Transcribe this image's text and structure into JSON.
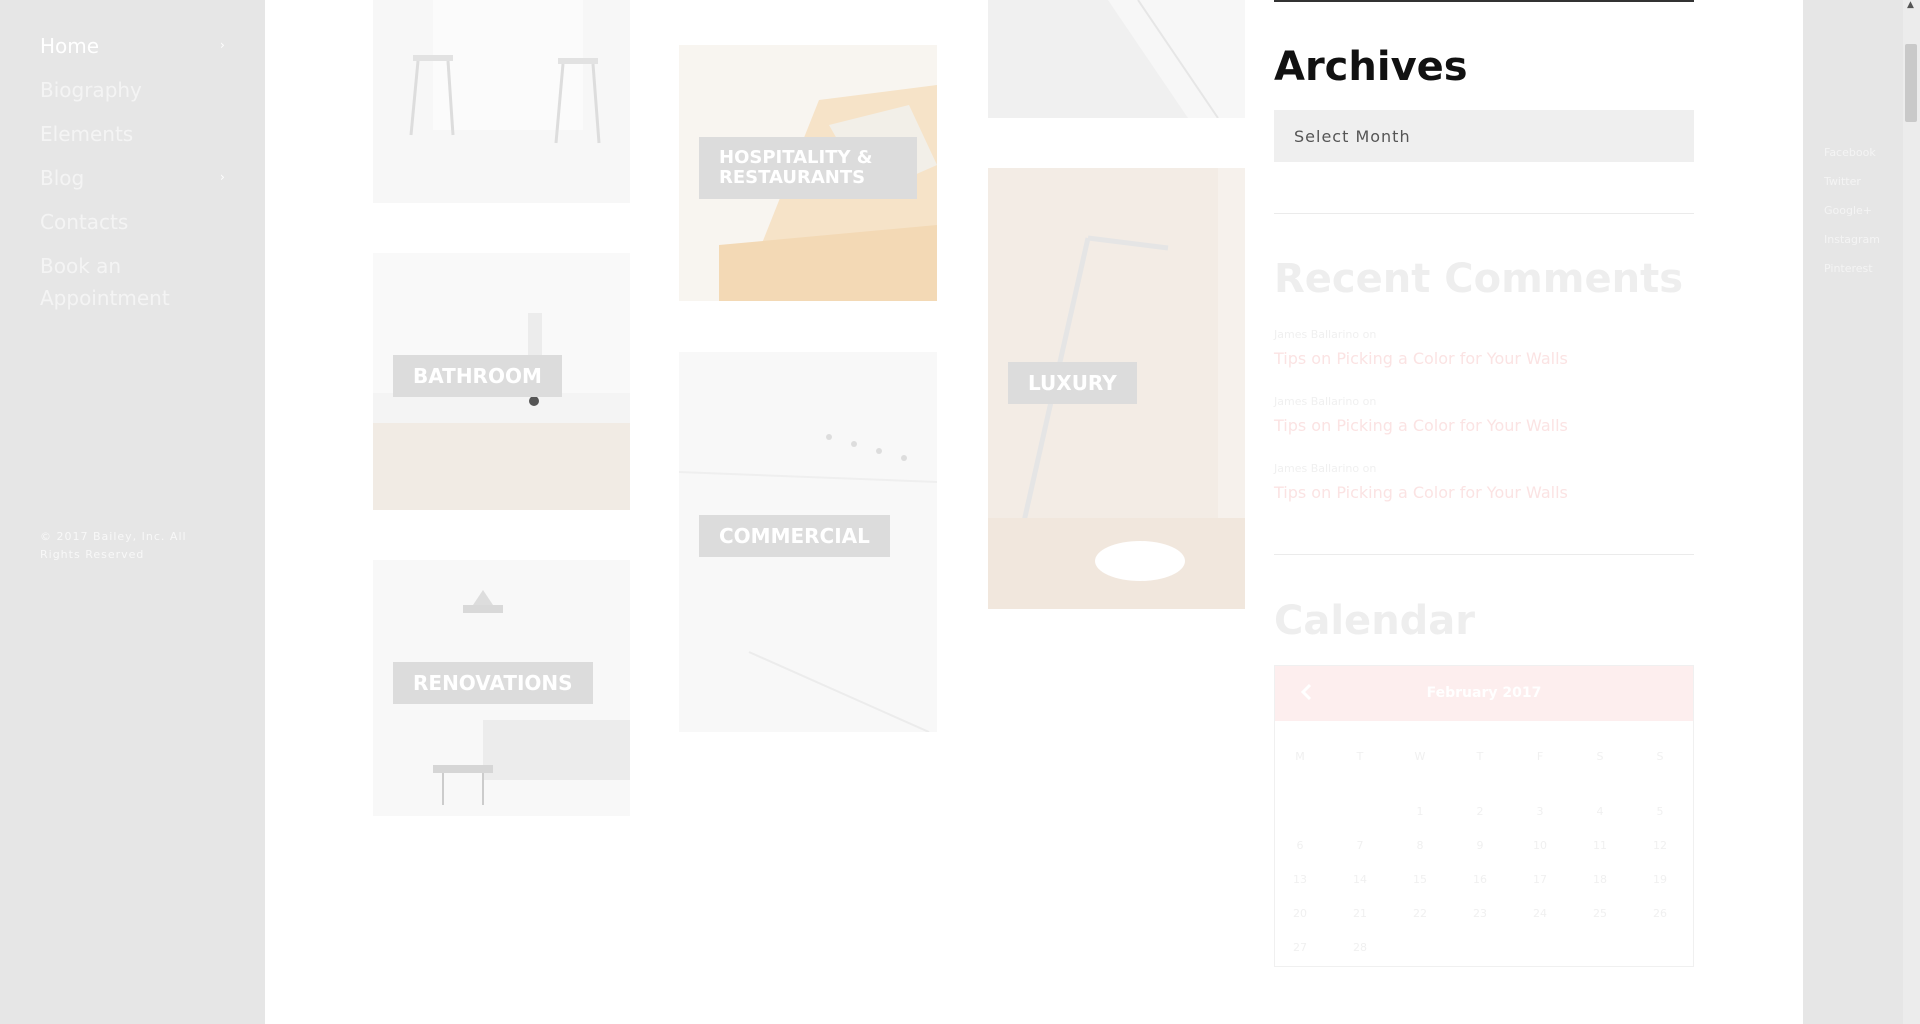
{
  "nav": {
    "items": [
      {
        "label": "Home"
      },
      {
        "label": "Biography"
      },
      {
        "label": "Elements"
      },
      {
        "label": "Blog"
      },
      {
        "label": "Contacts"
      },
      {
        "label": "Book an Appointment"
      }
    ],
    "copyright": "© 2017 Bailey, Inc. All Rights Reserved"
  },
  "social": [
    "Facebook",
    "Twitter",
    "Google+",
    "Instagram",
    "Pinterest"
  ],
  "portfolio": {
    "hospitality": "HOSPITALITY & RESTAURANTS",
    "bathroom": "BATHROOM",
    "luxury": "LUXURY",
    "commercial": "COMMERCIAL",
    "renovations": "RENOVATIONS"
  },
  "archives": {
    "title": "Archives",
    "select_value": "Select Month"
  },
  "recent_comments": {
    "title": "Recent Comments",
    "items": [
      {
        "author": "James Ballarino on",
        "link": "Tips on Picking a Color for Your Walls"
      },
      {
        "author": "James Ballarino on",
        "link": "Tips on Picking a Color for Your Walls"
      },
      {
        "author": "James Ballarino on",
        "link": "Tips on Picking a Color for Your Walls"
      }
    ]
  },
  "calendar": {
    "title": "Calendar",
    "month": "February 2017",
    "weekdays": [
      "M",
      "T",
      "W",
      "T",
      "F",
      "S",
      "S"
    ],
    "weeks": [
      [
        "",
        "",
        "1",
        "2",
        "3",
        "4",
        "5"
      ],
      [
        "6",
        "7",
        "8",
        "9",
        "10",
        "11",
        "12"
      ],
      [
        "13",
        "14",
        "15",
        "16",
        "17",
        "18",
        "19"
      ],
      [
        "20",
        "21",
        "22",
        "23",
        "24",
        "25",
        "26"
      ],
      [
        "27",
        "28",
        "",
        "",
        "",
        "",
        ""
      ]
    ]
  },
  "colors": {
    "sidebar_bg": "#e6e6e6",
    "label_bg": "#dcdcdc",
    "calendar_header": "#fdeeee"
  }
}
